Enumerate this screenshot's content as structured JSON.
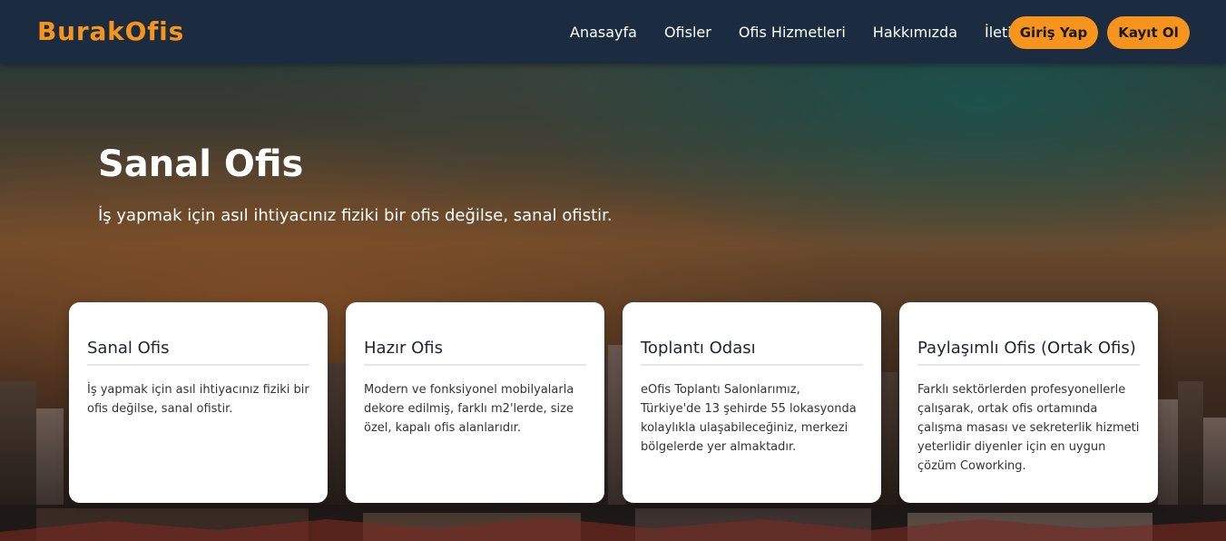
{
  "navbar": {
    "brand": "BurakOfis",
    "links": [
      "Anasayfa",
      "Ofisler",
      "Ofis Hizmetleri",
      "Hakkımızda",
      "İletişim"
    ],
    "login_label": "Giriş Yap",
    "signup_label": "Kayıt Ol"
  },
  "hero": {
    "title": "Sanal Ofis",
    "subtitle": "İş yapmak için asıl ihtiyacınız fiziki bir ofis değilse, sanal ofistir."
  },
  "cards": [
    {
      "title": "Sanal Ofis",
      "text": "İş yapmak için asıl ihtiyacınız fiziki bir ofis değilse, sanal ofistir."
    },
    {
      "title": "Hazır Ofis",
      "text": "Modern ve fonksiyonel mobilyalarla dekore edilmiş, farklı m2'lerde, size özel, kapalı ofis alanlarıdır."
    },
    {
      "title": "Toplantı Odası",
      "text": "eOfis Toplantı Salonlarımız, Türkiye'de 13 şehirde 55 lokasyonda kolaylıkla ulaşabileceğiniz, merkezi bölgelerde yer almaktadır."
    },
    {
      "title": "Paylaşımlı Ofis (Ortak Ofis)",
      "text": "Farklı sektörlerden profesyonellerle çalışarak, ortak ofis ortamında çalışma masası ve sekreterlik hizmeti yeterlidir diyenler için en uygun çözüm Coworking."
    }
  ],
  "colors": {
    "accent": "#f7941d",
    "navbar_bg": "#1b2c40",
    "card_bg": "#ffffff"
  }
}
